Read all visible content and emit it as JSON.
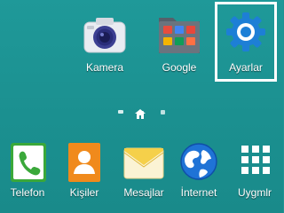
{
  "home": {
    "apps_top": [
      {
        "label": "Kamera"
      },
      {
        "label": "Google"
      },
      {
        "label": "Ayarlar"
      }
    ],
    "dock": [
      {
        "label": "Telefon"
      },
      {
        "label": "Kişiler"
      },
      {
        "label": "Mesajlar"
      },
      {
        "label": "İnternet"
      },
      {
        "label": "Uygmlr"
      }
    ]
  },
  "colors": {
    "background": "#1e9494",
    "highlight": "#ffffff",
    "settings_blue": "#1d7fd6",
    "phone_green": "#3aa83a",
    "contacts_orange": "#f08a1c",
    "messages_yellow": "#f5d04a"
  },
  "icons": {
    "camera": "camera-icon",
    "google": "google-folder-icon",
    "settings": "gear-icon",
    "phone": "phone-icon",
    "contacts": "contacts-icon",
    "messages": "envelope-icon",
    "internet": "globe-icon",
    "apps": "apps-grid-icon",
    "home_indicator": "home-icon"
  }
}
